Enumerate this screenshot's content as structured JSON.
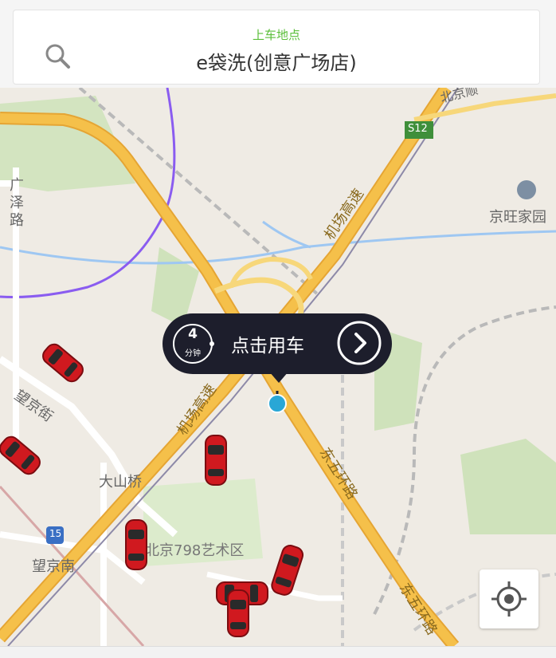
{
  "header": {
    "pickup_label": "上车地点",
    "pickup_value": "e袋洗(创意广场店)",
    "search_icon": "search-icon"
  },
  "map": {
    "labels": {
      "guangze_road": "广泽路",
      "jingwang_home": "京旺家园",
      "wangjing_street": "望京街",
      "dashanqiao": "大山桥",
      "art_zone_798": "北京798艺术区",
      "wangjingnan": "望京南",
      "airport_expressway": "机场高速",
      "airport_expressway_2": "机场高速",
      "east_5th_ring": "东五环路",
      "east_5th_ring_2": "东五环路",
      "north_top": "北京顺",
      "highway_shield": "S12",
      "metro_badge": "15"
    },
    "callout": {
      "eta_value": "4",
      "eta_unit": "分钟",
      "action_text": "点击用车"
    }
  },
  "colors": {
    "accent_green": "#5bbf3a",
    "callout_bg": "#1d1e2c",
    "pin_blue": "#29a7d6",
    "car_red": "#d0191f",
    "road_yellow": "#f5c04a"
  }
}
